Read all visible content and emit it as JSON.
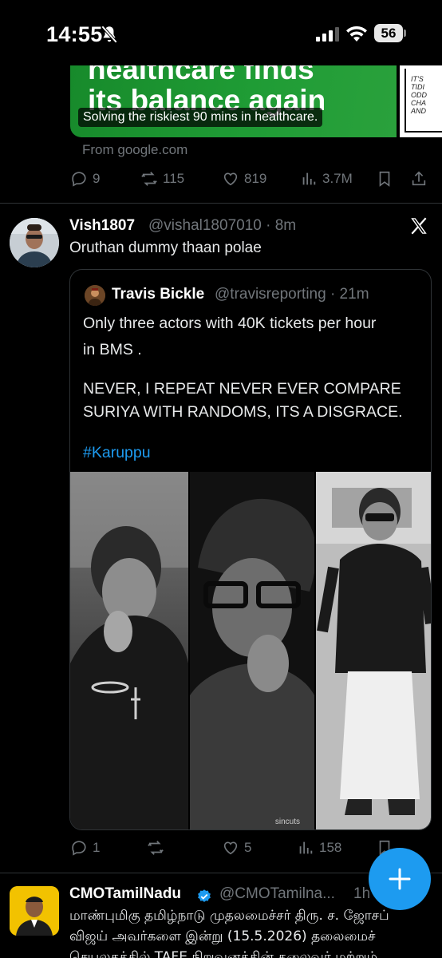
{
  "status_bar": {
    "time": "14:55",
    "battery": "56"
  },
  "ad": {
    "headline_line1": "healthcare finds",
    "headline_line2": "its balance again",
    "caption": "Solving the riskiest 90 mins in healthcare.",
    "side_text": [
      "IT'S",
      "TIDI",
      "ODD",
      "CHA",
      "AND"
    ],
    "source": "From google.com",
    "actions": {
      "replies": "9",
      "reposts": "115",
      "likes": "819",
      "views": "3.7M"
    }
  },
  "tweet": {
    "name": "Vish1807",
    "handle": "@vishal1807010 · 8m",
    "text": "Oruthan dummy thaan polae",
    "quote": {
      "name": "Travis Bickle",
      "handle": "@travisreporting · 21m",
      "lines": [
        "Only three actors with 40K tickets per hour",
        "in BMS .",
        "NEVER, I REPEAT NEVER EVER COMPARE",
        "SURIYA WITH RANDOMS, ITS A DISGRACE."
      ],
      "hashtag": "#Karuppu",
      "watermark": "sincuts"
    },
    "actions": {
      "replies": "1",
      "reposts": "",
      "likes": "5",
      "views": "158"
    }
  },
  "next_tweet": {
    "name": "CMOTamilNadu",
    "handle": "@CMOTamilna...",
    "time": "1h",
    "line1": "மாண்புமிகு தமிழ்நாடு முதலமைச்சர் திரு. ச. ஜோசப்",
    "line2": "விஜய் அவர்களை இன்று (15.5.2026) தலைமைச்",
    "line3": "செயலகத்தில் TAFE நிறுவனத்தின் தலைவர் மற்றும்"
  },
  "colors": {
    "accent": "#1d9bf0",
    "muted": "#71767b",
    "background": "#000000",
    "ad_green": "#1f9c35"
  }
}
